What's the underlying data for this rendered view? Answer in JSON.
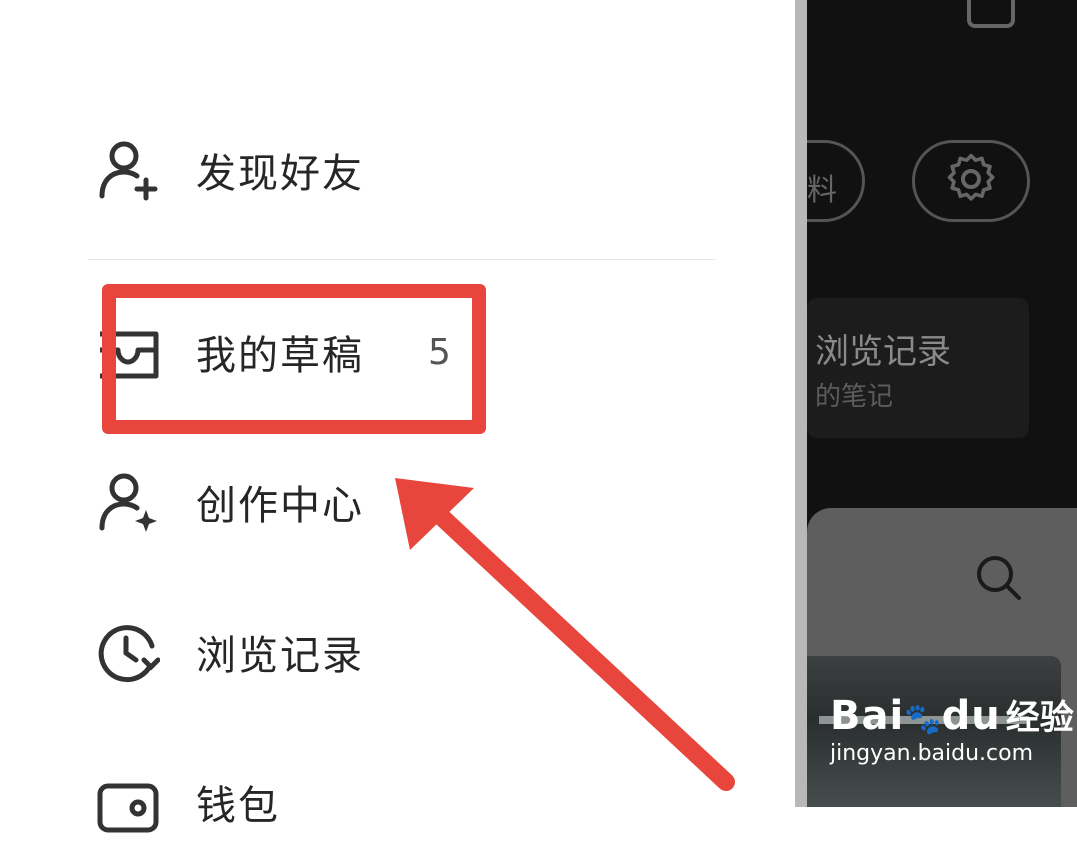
{
  "drawer": {
    "items": [
      {
        "label": "发现好友",
        "icon": "user-add-icon"
      },
      {
        "label": "我的草稿",
        "icon": "drafts-box-icon",
        "count": "5"
      },
      {
        "label": "创作中心",
        "icon": "user-star-icon"
      },
      {
        "label": "浏览记录",
        "icon": "history-clock-icon"
      },
      {
        "label": "钱包",
        "icon": "wallet-icon"
      }
    ]
  },
  "background_app": {
    "pill_text": "料",
    "card_title": "浏览记录",
    "card_subtitle": "的笔记"
  },
  "watermark": {
    "brand": "Bai",
    "brand_suffix": "du",
    "brand_cn": "经验",
    "url": "jingyan.baidu.com"
  },
  "colors": {
    "highlight": "#e8453c",
    "text": "#262626",
    "icon": "#333333"
  }
}
